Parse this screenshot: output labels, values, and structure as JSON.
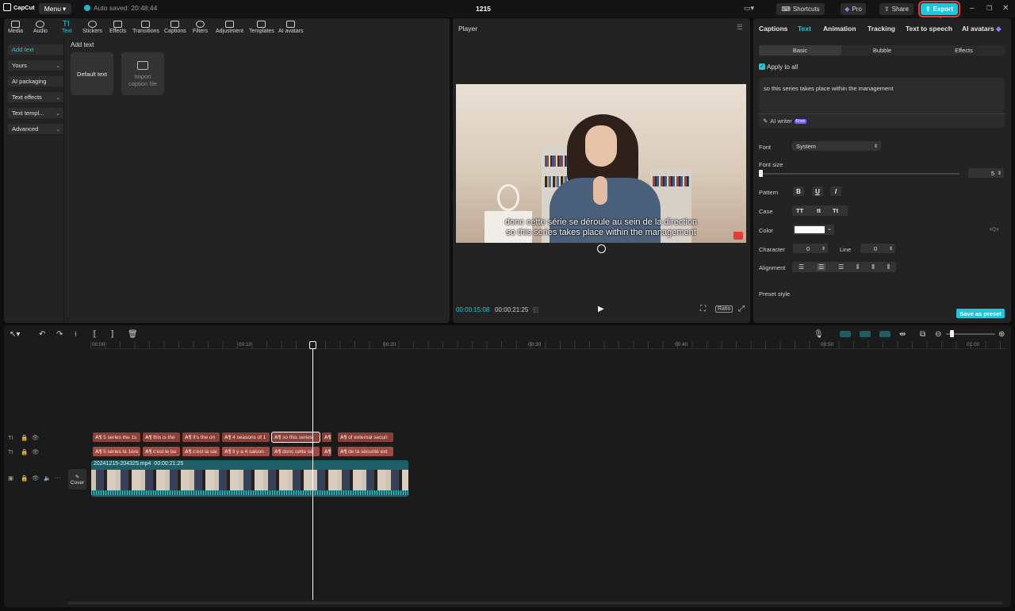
{
  "app": {
    "logo": "CapCut",
    "menu": "Menu",
    "autosave": "Auto saved: 20:48:44",
    "title": "1215"
  },
  "header": {
    "shortcuts": "Shortcuts",
    "pro": "Pro",
    "share": "Share",
    "export": "Export"
  },
  "toolbar": [
    "Media",
    "Audio",
    "Text",
    "Stickers",
    "Effects",
    "Transitions",
    "Captions",
    "Filters",
    "Adjustment",
    "Templates",
    "AI avatars"
  ],
  "sidebar": [
    "Add text",
    "Yours",
    "AI packaging",
    "Text effects",
    "Text templ...",
    "Advanced"
  ],
  "content": {
    "heading": "Add text",
    "default_text": "Default text",
    "import": "Import caption file"
  },
  "player": {
    "title": "Player",
    "time_current": "00:00:15:08",
    "time_total": "00:00:21:25",
    "ratio": "Ratio",
    "caption_top": "donc cette série se déroule au sein de la direction",
    "caption_bottom": "so this series takes place within the management"
  },
  "right": {
    "tabs": [
      "Captions",
      "Text",
      "Animation",
      "Tracking",
      "Text to speech",
      "AI avatars"
    ],
    "subtabs": [
      "Basic",
      "Bubble",
      "Effects"
    ],
    "apply_all": "Apply to all",
    "text_value": "so this series takes place within the management",
    "ai_writer": "AI writer",
    "ai_badge": "Free",
    "font_label": "Font",
    "font_value": "System",
    "font_size_label": "Font size",
    "font_size_value": "5",
    "pattern_label": "Pattern",
    "case_label": "Case",
    "case_opts": [
      "TT",
      "tt",
      "Tt"
    ],
    "color_label": "Color",
    "character_label": "Character",
    "character_value": "0",
    "line_label": "Line",
    "line_value": "0",
    "alignment_label": "Alignment",
    "preset_label": "Preset style",
    "save_preset": "Save as preset"
  },
  "timeline": {
    "ruler": [
      "00:00",
      "00:10",
      "00:20",
      "00:30",
      "00:40",
      "00:50",
      "01:00"
    ],
    "track1": [
      "5 series the 1s",
      "this is the",
      "It's the on",
      "4 seasons of 1",
      "so this series",
      "",
      "of external securi"
    ],
    "track2": [
      "5 séries la 1ère",
      "c'est le bu",
      "c'est la sai",
      "Il y a 4 saison",
      "donc cette sé",
      "",
      "de la sécurité ext"
    ],
    "video_name": "20241215-204325.mp4",
    "video_duration": "00:00:21:25",
    "cover": "Cover"
  }
}
